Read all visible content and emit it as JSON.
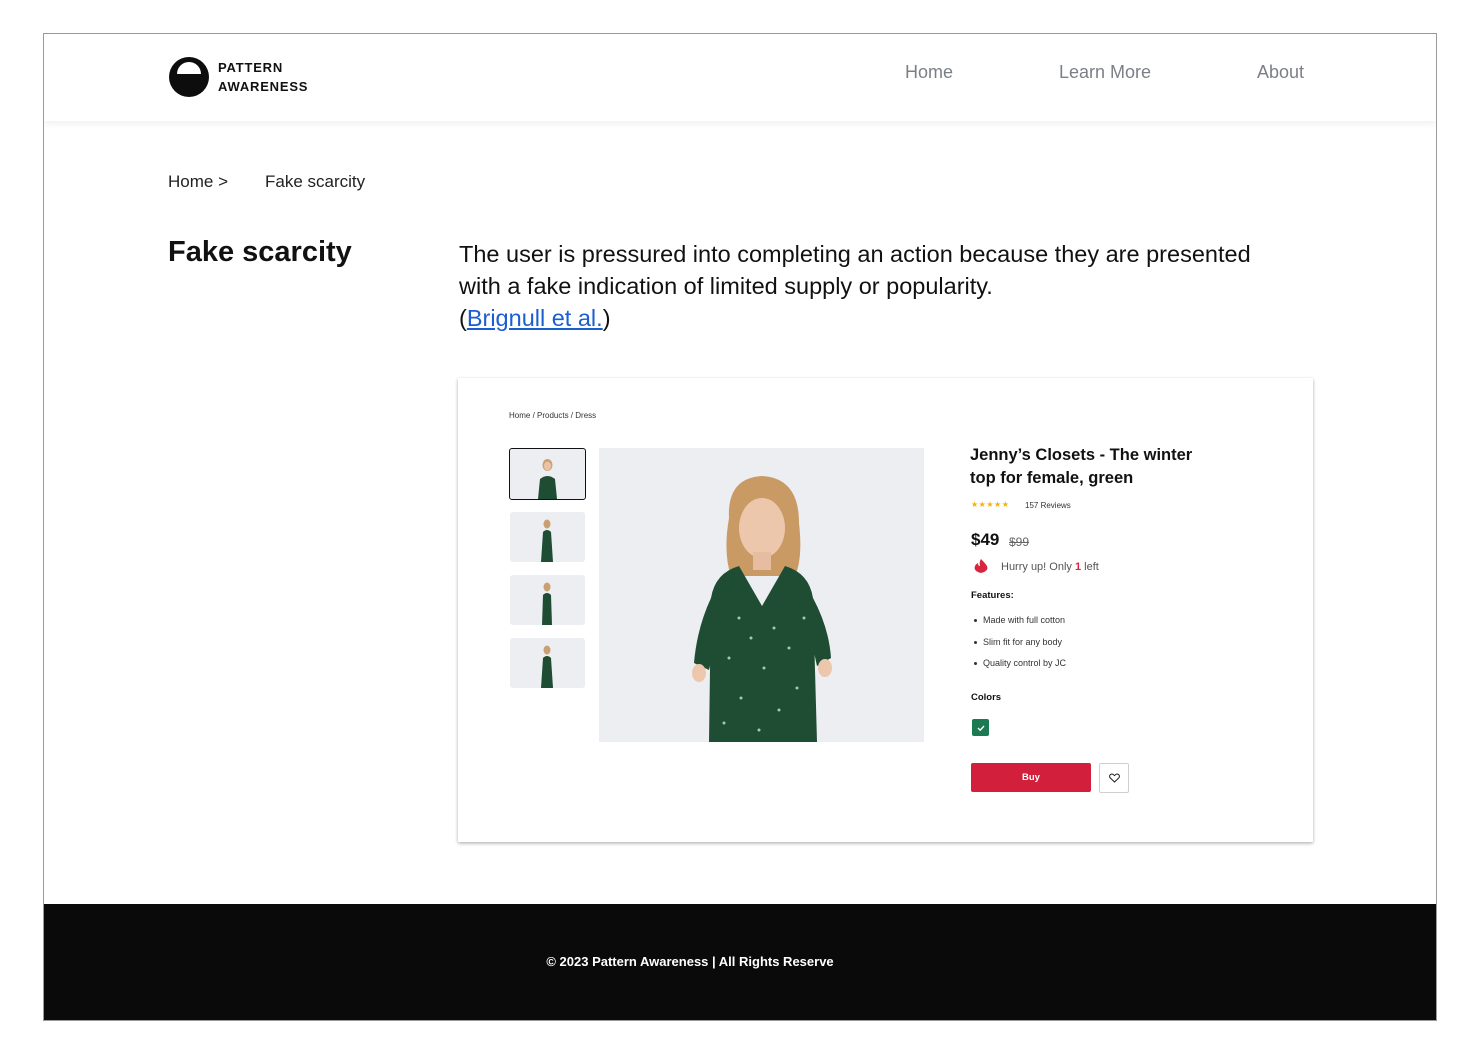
{
  "brand": {
    "line1": "PATTERN",
    "line2": "AWARENESS"
  },
  "nav": {
    "home": "Home",
    "learn_more": "Learn More",
    "about": "About"
  },
  "breadcrumb": {
    "home": "Home >",
    "current": "Fake scarcity"
  },
  "page": {
    "title": "Fake scarcity",
    "description": "The user is pressured into completing an action because they are presented with a fake indication of limited supply or popularity.",
    "citation_open": "(",
    "citation_link": "Brignull et al.",
    "citation_close": ")"
  },
  "demo": {
    "breadcrumb": "Home / Products / Dress",
    "product_title": "Jenny’s Closets - The winter top for female, green",
    "rating": 5,
    "rating_stars": "★★★★★",
    "reviews": "157 Reviews",
    "price": "$49",
    "old_price": "$99",
    "hurry_prefix": "Hurry up! Only ",
    "hurry_count": "1",
    "hurry_suffix": " left",
    "features_heading": "Features:",
    "features": [
      "Made with full cotton",
      "Slim fit for any body",
      "Quality control by JC"
    ],
    "colors_heading": "Colors",
    "selected_color": "#1b7a52",
    "buy_label": "Buy"
  },
  "footer": {
    "text": "© 2023 Pattern Awareness | All Rights Reserve"
  },
  "colors": {
    "link": "#1a5fd0",
    "buy": "#d21f3c",
    "star": "#f5b200",
    "footer_bg": "#0a0a0a"
  }
}
